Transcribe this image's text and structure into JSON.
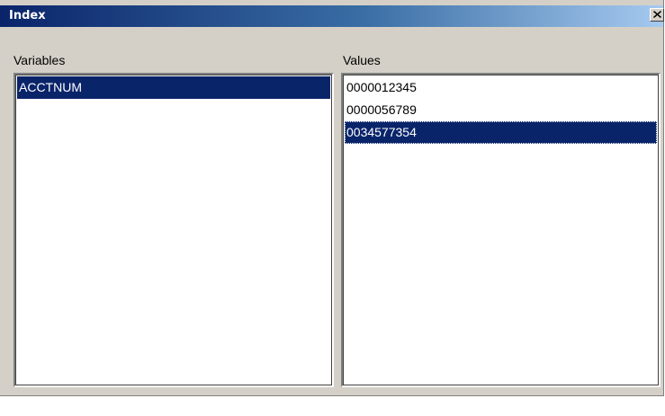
{
  "window": {
    "title": "Index",
    "close_label": "×"
  },
  "variables": {
    "label": "Variables",
    "items": [
      {
        "text": "ACCTNUM",
        "selected": true
      }
    ]
  },
  "values": {
    "label": "Values",
    "items": [
      {
        "text": "0000012345",
        "selected": false
      },
      {
        "text": "0000056789",
        "selected": false
      },
      {
        "text": "0034577354",
        "selected": true
      }
    ]
  },
  "colors": {
    "selection_bg": "#0a246a",
    "selection_fg": "#ffffff",
    "dialog_bg": "#d4d0c8"
  }
}
